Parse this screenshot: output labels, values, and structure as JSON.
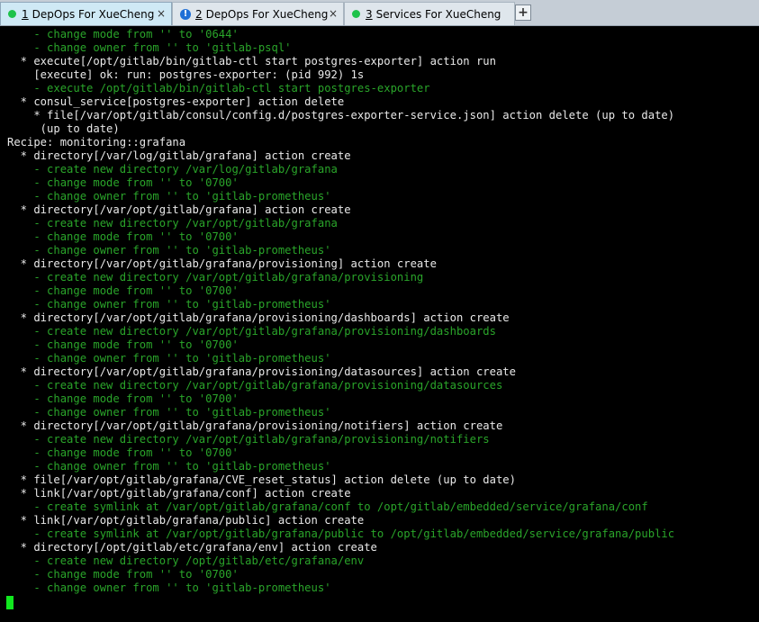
{
  "tabs": [
    {
      "number": "1",
      "label": "DepOps For XueCheng",
      "status": "connected",
      "close": "×"
    },
    {
      "number": "2",
      "label": "DepOps For XueCheng",
      "status": "warning",
      "close": "×"
    },
    {
      "number": "3",
      "label": "Services For XueCheng",
      "status": "connected"
    }
  ],
  "add_tab_label": "+",
  "status_colors": {
    "connected": "#1ec24a",
    "warning": "#1f6fd6"
  },
  "terminal_lines": [
    {
      "text": "    - change mode from '' to '0644'",
      "style": "g"
    },
    {
      "text": "    - change owner from '' to 'gitlab-psql'",
      "style": "g"
    },
    {
      "text": "  * execute[/opt/gitlab/bin/gitlab-ctl start postgres-exporter] action run",
      "style": "w"
    },
    {
      "text": "    [execute] ok: run: postgres-exporter: (pid 992) 1s",
      "style": "w"
    },
    {
      "text": "    - execute /opt/gitlab/bin/gitlab-ctl start postgres-exporter",
      "style": "g"
    },
    {
      "text": "  * consul_service[postgres-exporter] action delete",
      "style": "w"
    },
    {
      "text": "    * file[/var/opt/gitlab/consul/config.d/postgres-exporter-service.json] action delete (up to date)",
      "style": "w"
    },
    {
      "text": "     (up to date)",
      "style": "w"
    },
    {
      "text": "Recipe: monitoring::grafana",
      "style": "w"
    },
    {
      "text": "  * directory[/var/log/gitlab/grafana] action create",
      "style": "w"
    },
    {
      "text": "    - create new directory /var/log/gitlab/grafana",
      "style": "g"
    },
    {
      "text": "    - change mode from '' to '0700'",
      "style": "g"
    },
    {
      "text": "    - change owner from '' to 'gitlab-prometheus'",
      "style": "g"
    },
    {
      "text": "  * directory[/var/opt/gitlab/grafana] action create",
      "style": "w"
    },
    {
      "text": "    - create new directory /var/opt/gitlab/grafana",
      "style": "g"
    },
    {
      "text": "    - change mode from '' to '0700'",
      "style": "g"
    },
    {
      "text": "    - change owner from '' to 'gitlab-prometheus'",
      "style": "g"
    },
    {
      "text": "  * directory[/var/opt/gitlab/grafana/provisioning] action create",
      "style": "w"
    },
    {
      "text": "    - create new directory /var/opt/gitlab/grafana/provisioning",
      "style": "g"
    },
    {
      "text": "    - change mode from '' to '0700'",
      "style": "g"
    },
    {
      "text": "    - change owner from '' to 'gitlab-prometheus'",
      "style": "g"
    },
    {
      "text": "  * directory[/var/opt/gitlab/grafana/provisioning/dashboards] action create",
      "style": "w"
    },
    {
      "text": "    - create new directory /var/opt/gitlab/grafana/provisioning/dashboards",
      "style": "g"
    },
    {
      "text": "    - change mode from '' to '0700'",
      "style": "g"
    },
    {
      "text": "    - change owner from '' to 'gitlab-prometheus'",
      "style": "g"
    },
    {
      "text": "  * directory[/var/opt/gitlab/grafana/provisioning/datasources] action create",
      "style": "w"
    },
    {
      "text": "    - create new directory /var/opt/gitlab/grafana/provisioning/datasources",
      "style": "g"
    },
    {
      "text": "    - change mode from '' to '0700'",
      "style": "g"
    },
    {
      "text": "    - change owner from '' to 'gitlab-prometheus'",
      "style": "g"
    },
    {
      "text": "  * directory[/var/opt/gitlab/grafana/provisioning/notifiers] action create",
      "style": "w"
    },
    {
      "text": "    - create new directory /var/opt/gitlab/grafana/provisioning/notifiers",
      "style": "g"
    },
    {
      "text": "    - change mode from '' to '0700'",
      "style": "g"
    },
    {
      "text": "    - change owner from '' to 'gitlab-prometheus'",
      "style": "g"
    },
    {
      "text": "  * file[/var/opt/gitlab/grafana/CVE_reset_status] action delete (up to date)",
      "style": "w"
    },
    {
      "text": "  * link[/var/opt/gitlab/grafana/conf] action create",
      "style": "w"
    },
    {
      "text": "    - create symlink at /var/opt/gitlab/grafana/conf to /opt/gitlab/embedded/service/grafana/conf",
      "style": "g"
    },
    {
      "text": "  * link[/var/opt/gitlab/grafana/public] action create",
      "style": "w"
    },
    {
      "text": "    - create symlink at /var/opt/gitlab/grafana/public to /opt/gitlab/embedded/service/grafana/public",
      "style": "g"
    },
    {
      "text": "  * directory[/opt/gitlab/etc/grafana/env] action create",
      "style": "w"
    },
    {
      "text": "    - create new directory /opt/gitlab/etc/grafana/env",
      "style": "g"
    },
    {
      "text": "    - change mode from '' to '0700'",
      "style": "g"
    },
    {
      "text": "    - change owner from '' to 'gitlab-prometheus'",
      "style": "g"
    }
  ]
}
